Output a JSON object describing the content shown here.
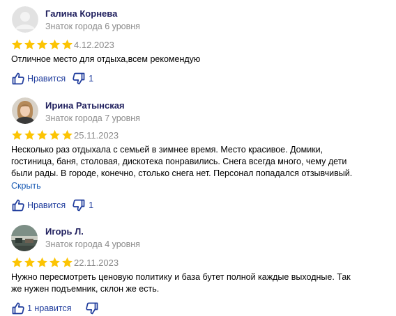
{
  "colors": {
    "star": "#fcc403",
    "author_name": "#21215f",
    "meta_text": "#8a8a8a",
    "link": "#1a5bb4",
    "action_icon": "#1e3b9c"
  },
  "reviews": [
    {
      "author": "Галина Корнева",
      "level": "Знаток города 6 уровня",
      "rating": 5,
      "date": "4.12.2023",
      "text_lines": [
        "Отличное место для отдыха,всем рекомендую"
      ],
      "hide_label": "",
      "like_label": "Нравится",
      "dislike_count": "1",
      "avatar_icon": "user-placeholder-icon"
    },
    {
      "author": "Ирина Ратынская",
      "level": "Знаток города 7 уровня",
      "rating": 5,
      "date": "25.11.2023",
      "text_lines": [
        "Несколько раз отдыхала с семьей в зимнее время. Место красивое. Домики,",
        "гостиница, баня, столовая, дискотека понравились. Снега всегда много, чему дети",
        "были рады. В городе, конечно, столько снега нет. Персонал попадался отзывчивый."
      ],
      "hide_label": "Скрыть",
      "like_label": "Нравится",
      "dislike_count": "1",
      "avatar_icon": "woman-portrait-icon"
    },
    {
      "author": "Игорь Л.",
      "level": "Знаток города 4 уровня",
      "rating": 5,
      "date": "22.11.2023",
      "text_lines": [
        "Нужно пересмотреть ценовую политику и база бутет полной каждые выходные. Так",
        "же нужен подъемник, склон же есть."
      ],
      "hide_label": "",
      "like_label": "1 нравится",
      "dislike_count": "",
      "avatar_icon": "landscape-photo-icon"
    }
  ]
}
